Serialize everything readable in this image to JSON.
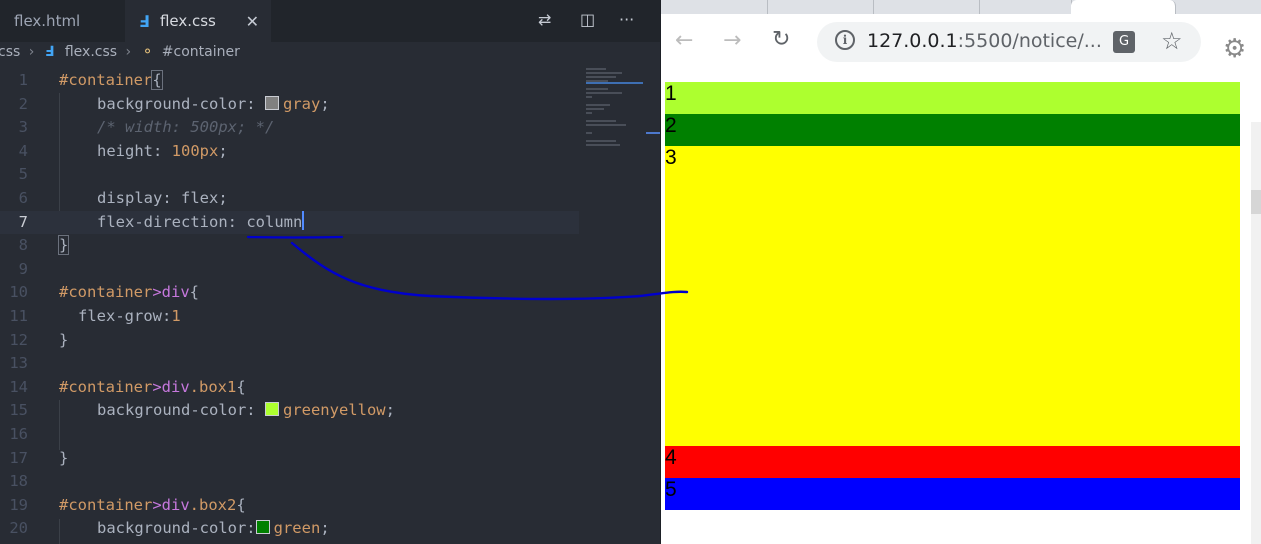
{
  "editor": {
    "tabs": [
      {
        "label": "flex.html",
        "active": false
      },
      {
        "label": "flex.css",
        "active": true,
        "icon": "css3-icon",
        "close": "✕"
      }
    ],
    "toolbar_icons": [
      "source-control-compare-icon",
      "split-editor-icon",
      "more-actions-icon"
    ],
    "breadcrumb": {
      "folder": "css",
      "file": "flex.css",
      "symbol": "#container"
    },
    "current_line": 7,
    "line_numbers": [
      "1",
      "2",
      "3",
      "4",
      "5",
      "6",
      "7",
      "8",
      "9",
      "10",
      "11",
      "12",
      "13",
      "14",
      "15",
      "16",
      "17",
      "18",
      "19",
      "20"
    ],
    "lines": {
      "l1": {
        "sel": "#container",
        "brace": "{"
      },
      "l2": {
        "prop": "background-color:",
        "value": "gray",
        "end": ";",
        "swatch": "#808080"
      },
      "l3": {
        "comment": "/* width: 500px; */"
      },
      "l4": {
        "prop": "height:",
        "value": "100px",
        "end": ";"
      },
      "l6": {
        "prop": "display:",
        "value": "flex",
        "end": ";"
      },
      "l7": {
        "prop": "flex-direction:",
        "value": "column"
      },
      "l8": {
        "brace": "}"
      },
      "l10": {
        "sel": "#container",
        "gt": ">",
        "tag": "div",
        "brace": "{"
      },
      "l11": {
        "prop": "flex-grow:",
        "value": "1"
      },
      "l12": {
        "brace": "}"
      },
      "l14": {
        "sel": "#container",
        "gt": ">",
        "tag": "div",
        "cls": ".box1",
        "brace": "{"
      },
      "l15": {
        "prop": "background-color:",
        "value": "greenyellow",
        "end": ";",
        "swatch": "#adff2f"
      },
      "l17": {
        "brace": "}"
      },
      "l19": {
        "sel": "#container",
        "gt": ">",
        "tag": "div",
        "cls": ".box2",
        "brace": "{"
      },
      "l20": {
        "prop": "background-color:",
        "value": "green",
        "end": ";",
        "swatch": "#008000"
      }
    }
  },
  "browser": {
    "nav": {
      "back": "←",
      "forward": "→",
      "reload": "↻"
    },
    "url": {
      "host": "127.0.0.1",
      "rest": ":5500/notice/..."
    },
    "icons": [
      "info-icon",
      "translate-icon",
      "bookmark-star-icon",
      "extension-gear-icon"
    ],
    "boxes": [
      {
        "label": "1",
        "color": "#adff2f"
      },
      {
        "label": "2",
        "color": "#008000"
      },
      {
        "label": "3",
        "color": "#ffff00"
      },
      {
        "label": "4",
        "color": "#ff0000"
      },
      {
        "label": "5",
        "color": "#0000ff"
      }
    ]
  },
  "annotation": {
    "color": "#0000cc"
  }
}
